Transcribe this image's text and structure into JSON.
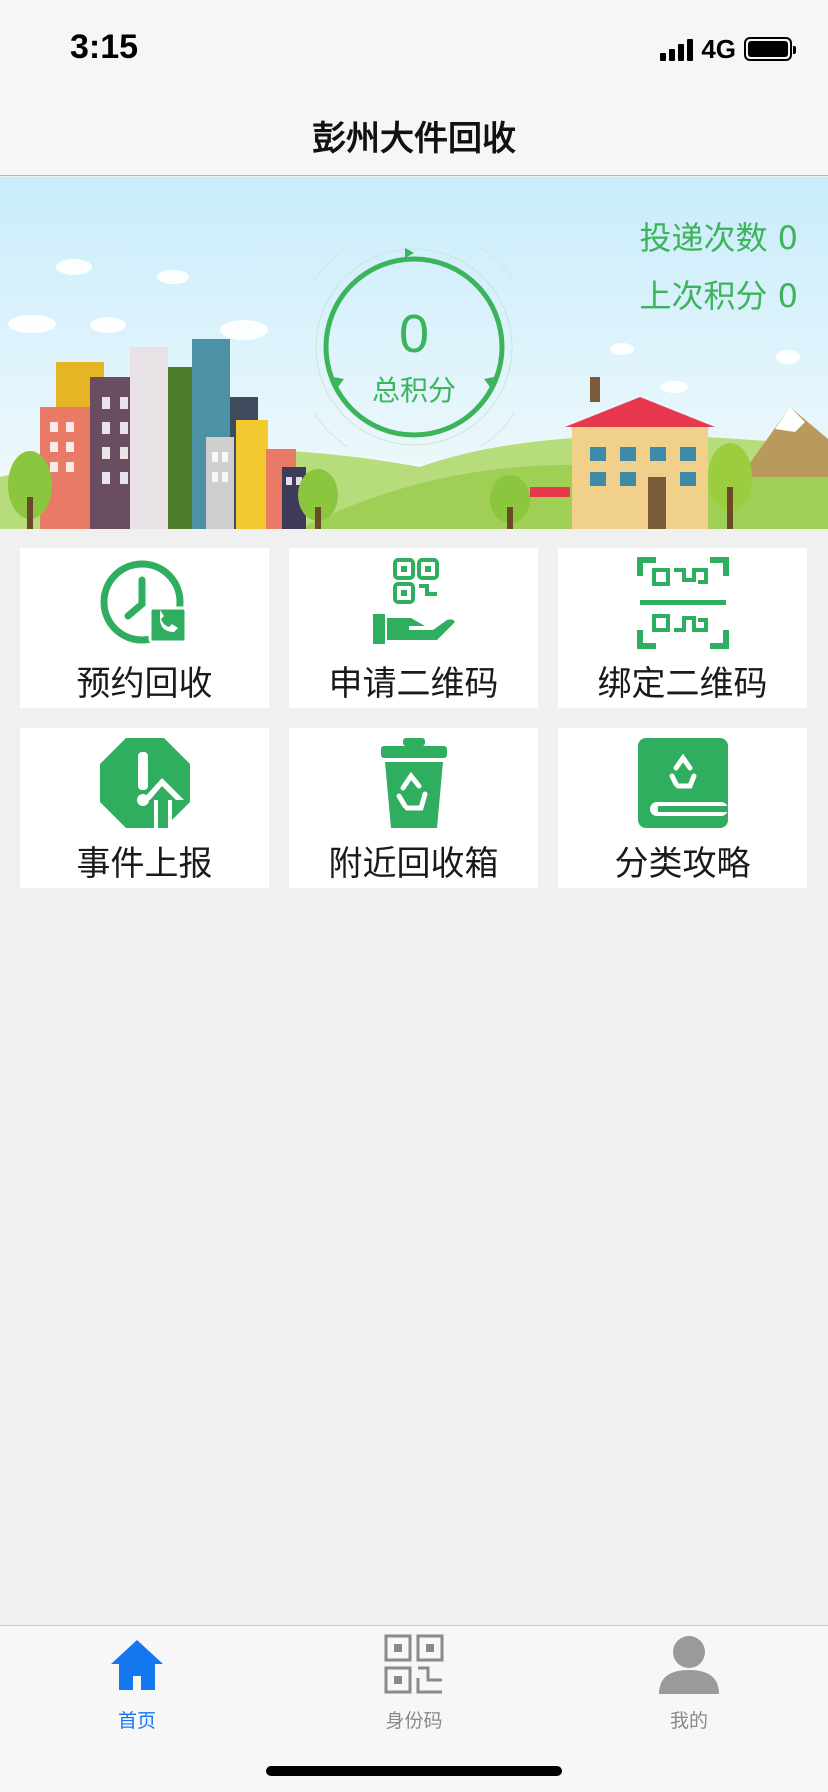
{
  "status_bar": {
    "time": "3:15",
    "network": "4G"
  },
  "nav": {
    "title": "彭州大件回收"
  },
  "banner": {
    "total_points_value": "0",
    "total_points_label": "总积分",
    "delivery_count_text": "投递次数 0",
    "last_points_text": "上次积分 0"
  },
  "menu": {
    "items": [
      {
        "label": "预约回收",
        "icon": "clock-phone-icon"
      },
      {
        "label": "申请二维码",
        "icon": "qr-hand-icon"
      },
      {
        "label": "绑定二维码",
        "icon": "qr-scan-icon"
      },
      {
        "label": "事件上报",
        "icon": "warning-report-icon"
      },
      {
        "label": "附近回收箱",
        "icon": "recycle-bin-icon"
      },
      {
        "label": "分类攻略",
        "icon": "recycle-book-icon"
      }
    ]
  },
  "tabbar": {
    "tabs": [
      {
        "label": "首页",
        "icon": "home-icon",
        "active": true
      },
      {
        "label": "身份码",
        "icon": "qr-code-icon",
        "active": false
      },
      {
        "label": "我的",
        "icon": "user-icon",
        "active": false
      }
    ]
  },
  "colors": {
    "accent_green": "#3cb45a",
    "active_blue": "#1577f0",
    "inactive_gray": "#8a8a8a"
  }
}
